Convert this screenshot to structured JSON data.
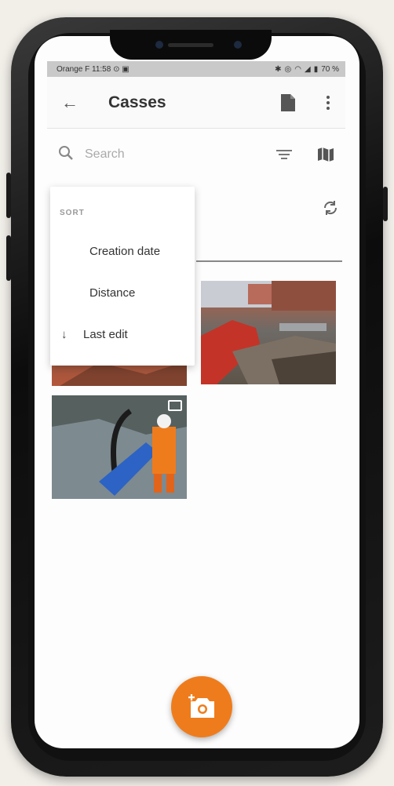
{
  "status_bar": {
    "left": "Orange F 11:58 ⊙ ▣",
    "right_icons": [
      "bluetooth-icon",
      "vibrate-icon",
      "wifi-icon",
      "signal-icon",
      "battery-icon"
    ],
    "battery": "70 %"
  },
  "app_bar": {
    "title": "Casses",
    "back_icon": "arrow-left-icon",
    "doc_icon": "document-icon",
    "more_icon": "more-vertical-icon"
  },
  "search": {
    "placeholder": "Search",
    "value": "",
    "filter_icon": "filter-icon",
    "map_icon": "map-icon"
  },
  "sort_menu": {
    "title": "SORT",
    "options": [
      {
        "label": "Creation date",
        "selected": false
      },
      {
        "label": "Distance",
        "selected": false
      },
      {
        "label": "Last edit",
        "selected": true,
        "direction_icon": "arrow-down-icon"
      }
    ]
  },
  "fab": {
    "icon": "add-photo-icon"
  },
  "colors": {
    "accent": "#ef7c1c",
    "appbar_bg": "#fafafa",
    "status_bg": "#c9c9c9"
  }
}
